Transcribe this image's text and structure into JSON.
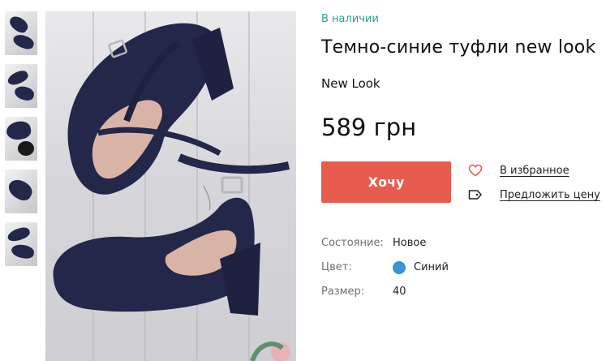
{
  "product": {
    "availability": "В наличии",
    "title": "Темно-синие туфли new look",
    "brand": "New Look",
    "price": "589 грн"
  },
  "actions": {
    "want_label": "Хочу",
    "favorite_label": "В избранное",
    "offer_label": "Предложить цену"
  },
  "specs": [
    {
      "label": "Состояние:",
      "value": "Новое"
    },
    {
      "label": "Цвет:",
      "value": "Синий",
      "swatch": "#3a93d6"
    },
    {
      "label": "Размер:",
      "value": "40"
    }
  ],
  "gallery": {
    "thumbnail_count": 5,
    "selected_index": 0
  },
  "colors": {
    "availability": "#2aa08a",
    "button": "#e85c4f",
    "shoe": "#232749",
    "accent_icon": "#e85c4f"
  },
  "icons": [
    "heart-icon",
    "tag-icon"
  ]
}
